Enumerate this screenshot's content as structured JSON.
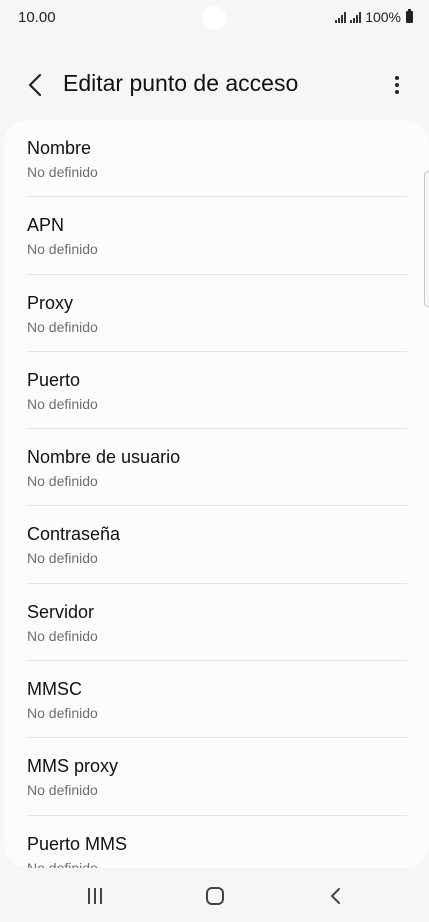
{
  "status_bar": {
    "time": "10.00",
    "battery_text": "100%"
  },
  "app_bar": {
    "title": "Editar punto de acceso",
    "back_icon": "chevron-left-icon",
    "more_icon": "more-vertical-icon"
  },
  "list": {
    "items": [
      {
        "label": "Nombre",
        "value": "No definido"
      },
      {
        "label": "APN",
        "value": "No definido"
      },
      {
        "label": "Proxy",
        "value": "No definido"
      },
      {
        "label": "Puerto",
        "value": "No definido"
      },
      {
        "label": "Nombre de usuario",
        "value": "No definido"
      },
      {
        "label": "Contraseña",
        "value": "No definido"
      },
      {
        "label": "Servidor",
        "value": "No definido"
      },
      {
        "label": "MMSC",
        "value": "No definido"
      },
      {
        "label": "MMS proxy",
        "value": "No definido"
      },
      {
        "label": "Puerto MMS",
        "value": "No definido"
      }
    ]
  },
  "nav_bar": {
    "icons": [
      "recents-icon",
      "home-icon",
      "back-icon"
    ]
  }
}
